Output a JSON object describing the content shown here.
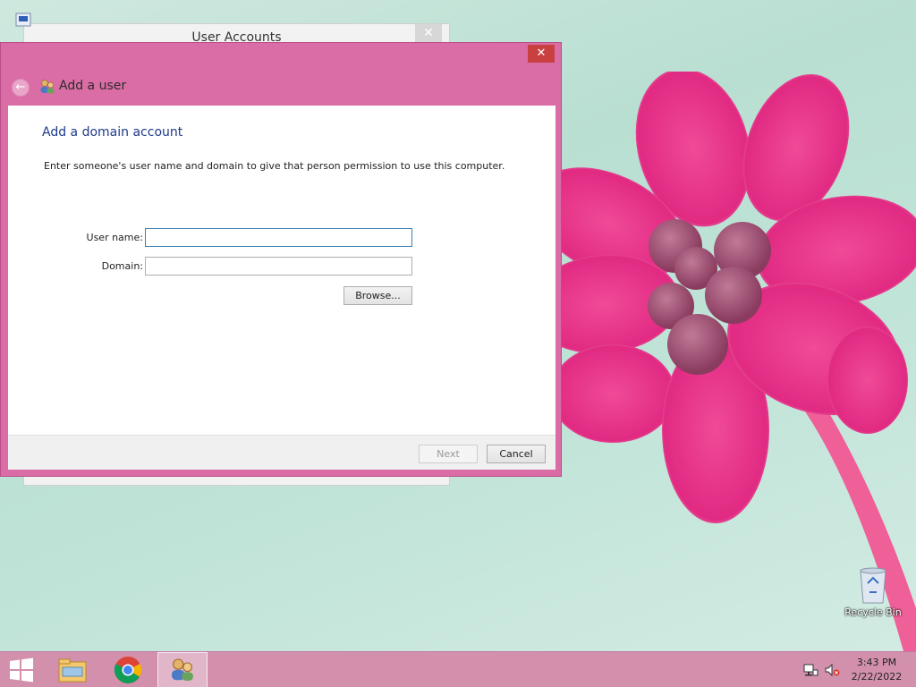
{
  "background_window": {
    "title": "User Accounts",
    "close_label": "✕"
  },
  "dialog": {
    "close_label": "✕",
    "back_label": "←",
    "header_title": "Add a user",
    "content_title": "Add a domain account",
    "instructions": "Enter someone's user name and domain to give that person permission to use this computer.",
    "username_label": "User name:",
    "username_value": "",
    "domain_label": "Domain:",
    "domain_value": "",
    "browse_label": "Browse...",
    "next_label": "Next",
    "cancel_label": "Cancel"
  },
  "desktop": {
    "recycle_bin_label": "Recycle Bin"
  },
  "taskbar": {
    "items": [
      {
        "name": "start-button",
        "icon": "windows-logo-icon"
      },
      {
        "name": "file-explorer",
        "icon": "folder-icon"
      },
      {
        "name": "chrome",
        "icon": "chrome-icon"
      },
      {
        "name": "user-accounts",
        "icon": "users-icon",
        "active": true
      }
    ],
    "time": "3:43 PM",
    "date": "2/22/2022"
  },
  "colors": {
    "dialog_frame": "#db6da6",
    "taskbar": "#d290ad",
    "title_text": "#1e3a8a",
    "close_button": "#c94040"
  }
}
